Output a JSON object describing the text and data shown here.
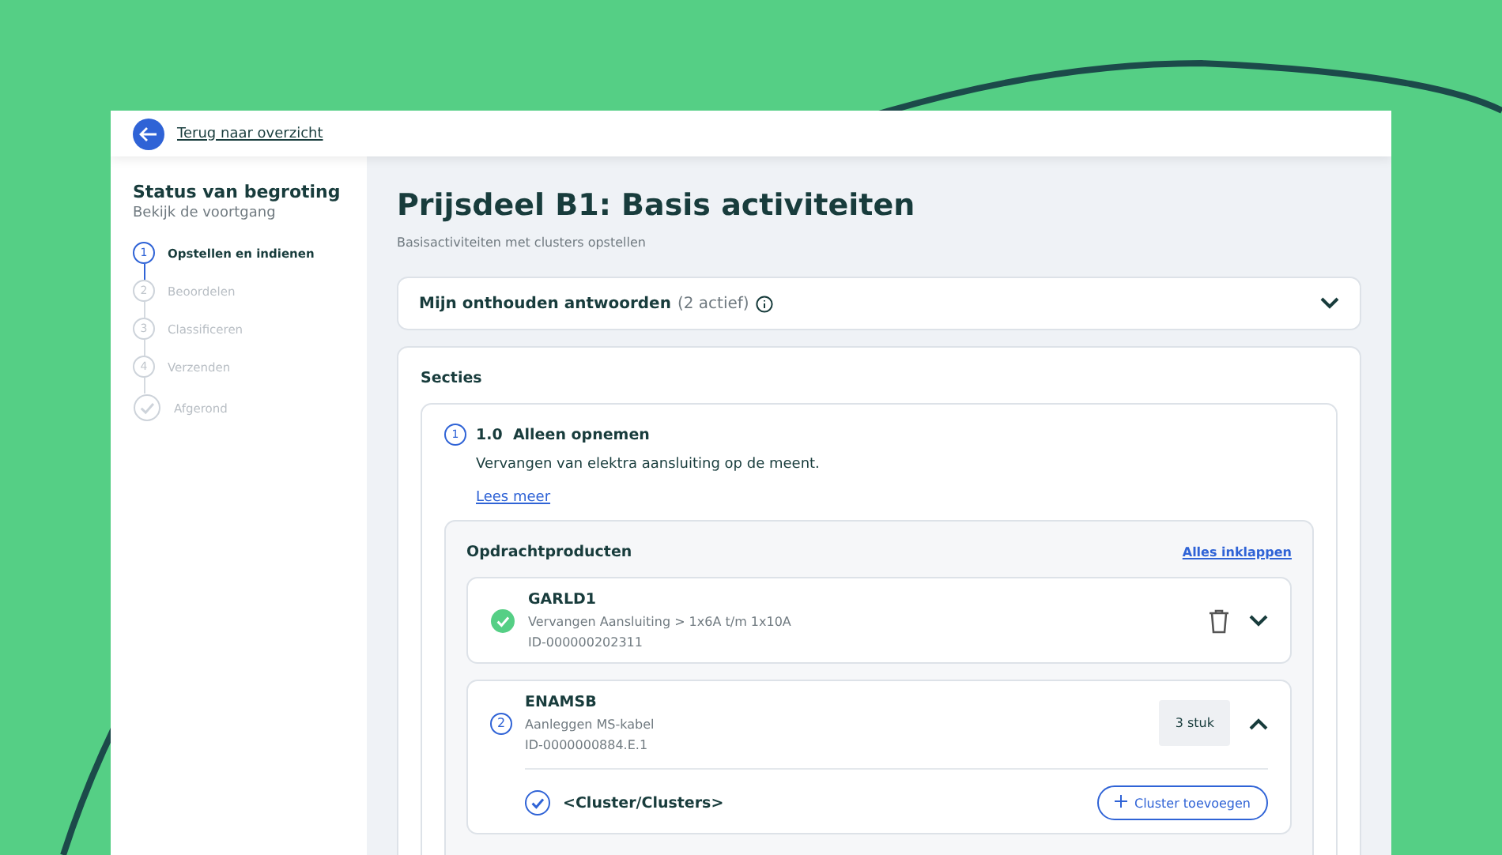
{
  "header": {
    "back_link": "Terug naar overzicht"
  },
  "sidebar": {
    "title": "Status van begroting",
    "subtitle": "Bekijk de voortgang",
    "steps": [
      {
        "kind": "number",
        "marker": "1",
        "label": "Opstellen en indienen",
        "selected": true
      },
      {
        "kind": "number",
        "marker": "2",
        "label": "Beoordelen",
        "selected": false
      },
      {
        "kind": "number",
        "marker": "3",
        "label": "Classificeren",
        "selected": false
      },
      {
        "kind": "number",
        "marker": "4",
        "label": "Verzenden",
        "selected": false
      },
      {
        "kind": "check",
        "label": "Afgerond",
        "selected": false
      }
    ]
  },
  "main": {
    "title": "Prijsdeel B1: Basis activiteiten",
    "subtitle": "Basisactiviteiten met clusters opstellen",
    "remembered": {
      "label": "Mijn onthouden antwoorden",
      "count": "(2 actief)",
      "expanded": false
    },
    "sections": {
      "title": "Secties",
      "section": {
        "marker": "1",
        "number": "1.0",
        "name": "Alleen opnemen",
        "description": "Vervangen van elektra aansluiting op de meent.",
        "link": "Lees meer",
        "products": {
          "title": "Opdrachtproducten",
          "collapse_link": "Alles inklappen",
          "items": [
            {
              "kind": "done",
              "code": "GARLD1",
              "description": "Vervangen Aansluiting > 1x6A t/m 1x10A",
              "id": "ID-000000202311",
              "expanded": false
            },
            {
              "kind": "number",
              "marker": "2",
              "code": "ENAMSB",
              "description": "Aanleggen MS-kabel",
              "id": "ID-0000000884.E.1",
              "quantity": "3 stuk",
              "expanded": true,
              "cluster": {
                "label": "<Cluster/Clusters>",
                "button": "Cluster toevoegen"
              }
            }
          ]
        }
      }
    }
  }
}
